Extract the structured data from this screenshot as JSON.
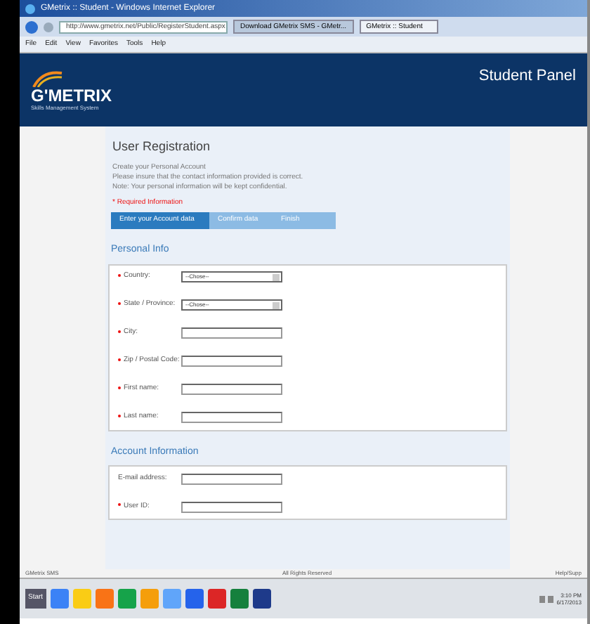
{
  "window": {
    "title": "GMetrix :: Student - Windows Internet Explorer"
  },
  "address_bar": {
    "url": "http://www.gmetrix.net/Public/RegisterStudent.aspx"
  },
  "tabs": [
    {
      "label": "Download GMetrix SMS - GMetr...",
      "selected": false
    },
    {
      "label": "GMetrix :: Student",
      "selected": true
    }
  ],
  "menu": [
    "File",
    "Edit",
    "View",
    "Favorites",
    "Tools",
    "Help"
  ],
  "header": {
    "logo": "G'METRIX",
    "tagline": "Skills Management System",
    "panel": "Student Panel"
  },
  "registration": {
    "title": "User Registration",
    "intro": [
      "Create your Personal Account",
      "Please insure that the contact information provided is correct.",
      "Note: Your personal information will be kept confidential."
    ],
    "required_note": "* Required Information",
    "steps": [
      {
        "label": "Enter your Account data",
        "selected": true
      },
      {
        "label": "Confirm data",
        "selected": false
      },
      {
        "label": "Finish",
        "selected": false
      }
    ]
  },
  "sections": [
    {
      "title": "Personal Info",
      "fields": [
        {
          "label": "Country:",
          "required": true,
          "kind": "select",
          "value": "--Chose--"
        },
        {
          "label": "State / Province:",
          "required": true,
          "kind": "select",
          "value": "--Chose--"
        },
        {
          "label": "City:",
          "required": true,
          "kind": "text"
        },
        {
          "label": "Zip / Postal Code:",
          "required": true,
          "kind": "text"
        },
        {
          "label": "First name:",
          "required": true,
          "kind": "text"
        },
        {
          "label": "Last name:",
          "required": true,
          "kind": "text"
        }
      ]
    },
    {
      "title": "Account Information",
      "fields": [
        {
          "label": "E-mail address:",
          "required": false,
          "kind": "text"
        },
        {
          "label": "User ID:",
          "required": true,
          "kind": "text"
        }
      ]
    }
  ],
  "footer": {
    "left": "GMetrix SMS",
    "center": "All Rights Reserved",
    "right": "Help/Supp"
  },
  "taskbar": {
    "start": "Start",
    "clock": [
      "3:10 PM",
      "6/17/2013"
    ]
  }
}
